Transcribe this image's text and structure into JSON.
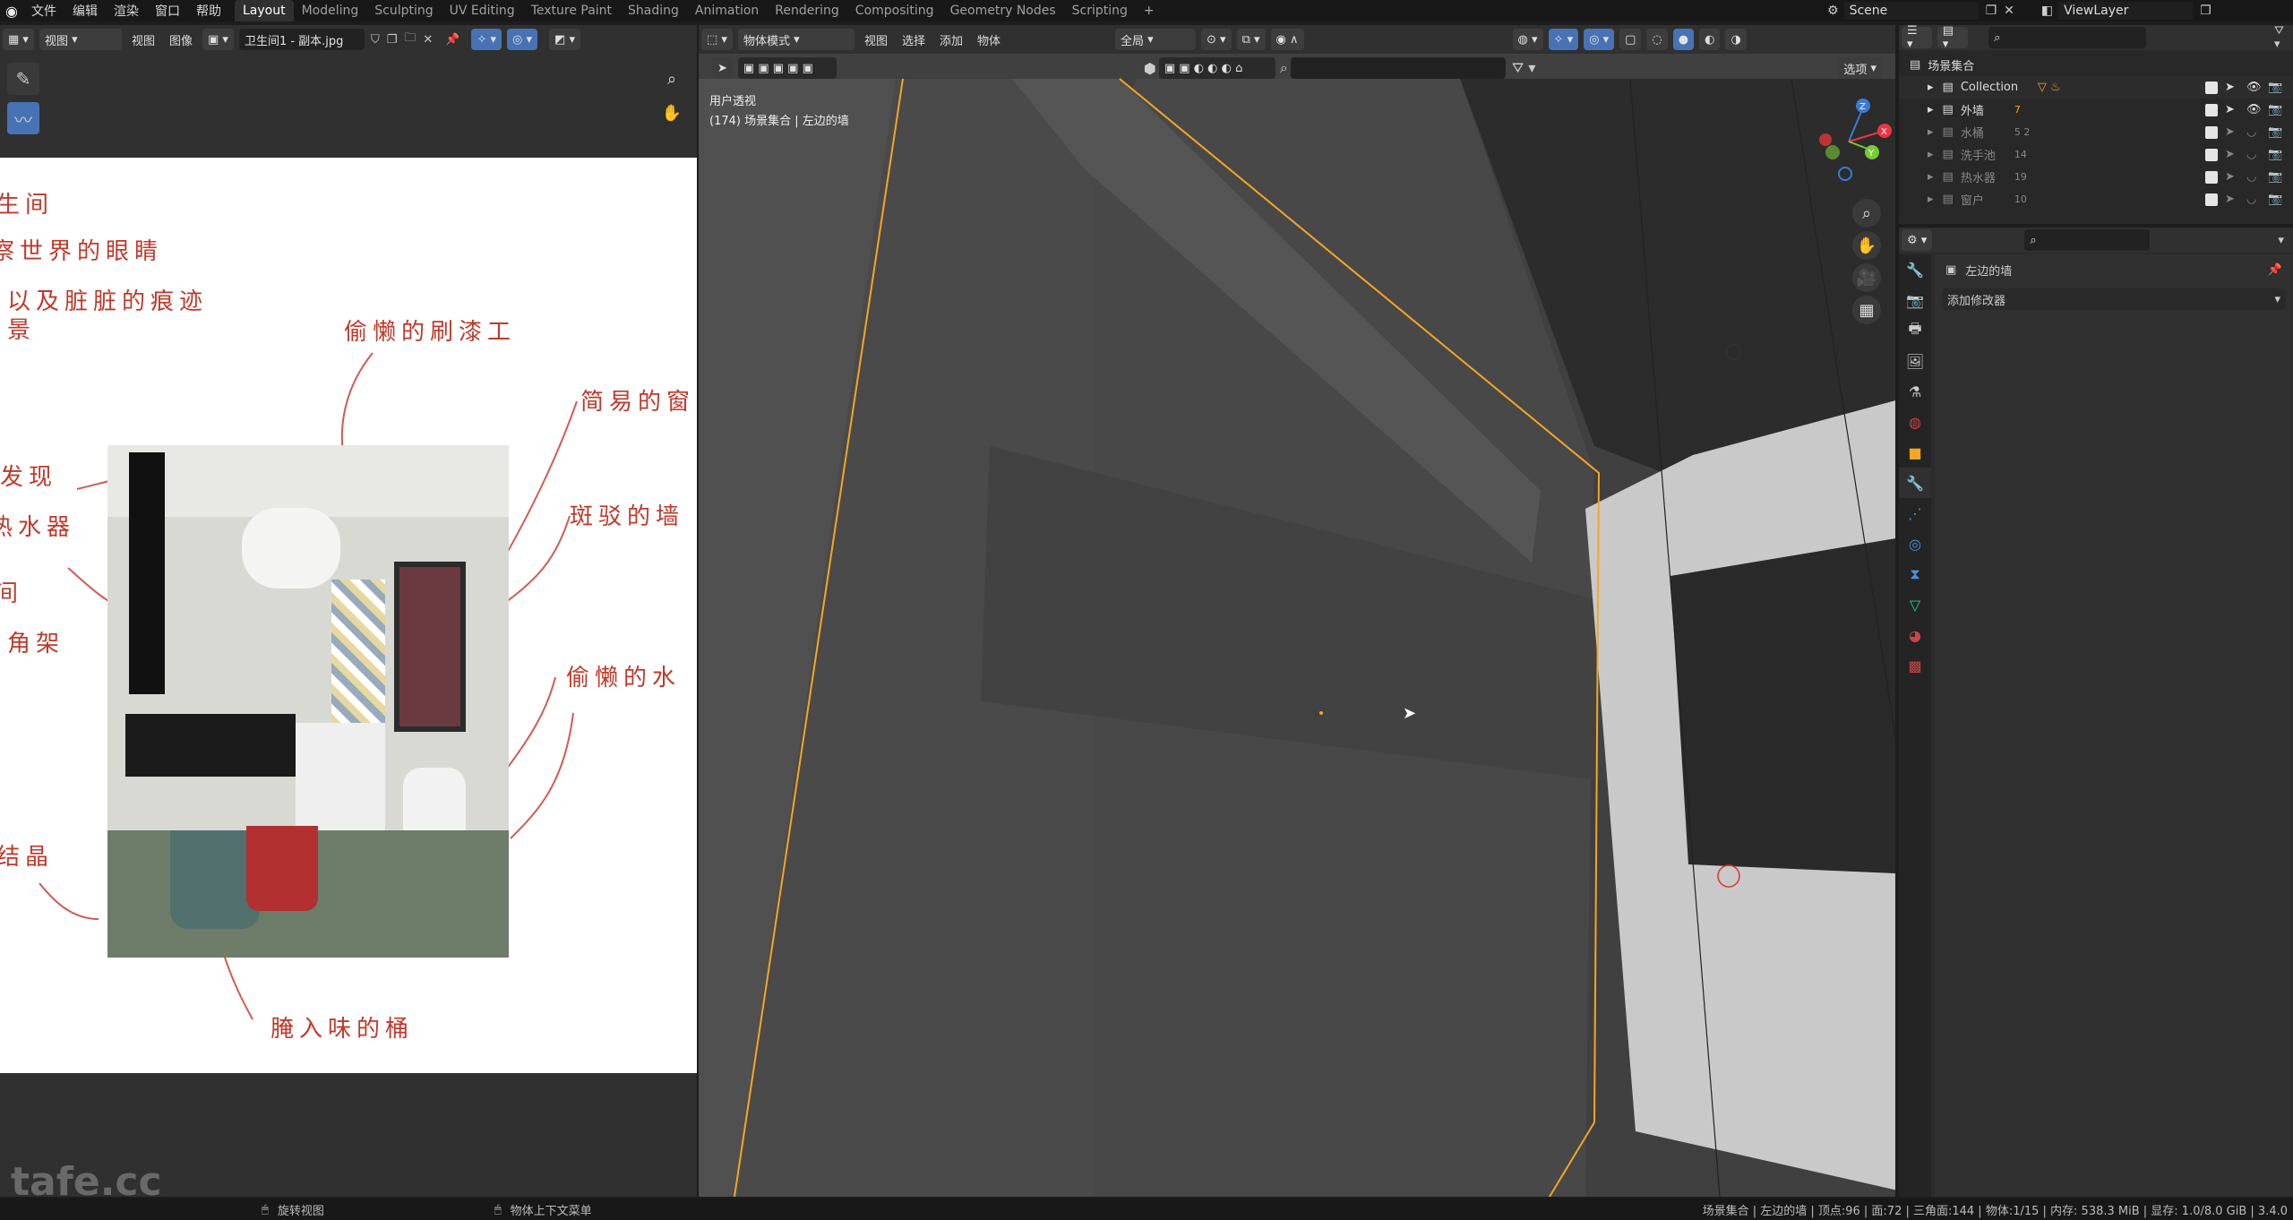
{
  "topbar": {
    "menus": [
      "文件",
      "编辑",
      "渲染",
      "窗口",
      "帮助"
    ],
    "workspaces": [
      "Layout",
      "Modeling",
      "Sculpting",
      "UV Editing",
      "Texture Paint",
      "Shading",
      "Animation",
      "Rendering",
      "Compositing",
      "Geometry Nodes",
      "Scripting"
    ],
    "active_workspace": "Layout",
    "scene": "Scene",
    "view_layer": "ViewLayer"
  },
  "image_editor": {
    "view_mode": "视图",
    "menu_view": "视图",
    "menu_image": "图像",
    "image_name": "卫生间1 - 副本.jpg",
    "annotations": [
      "生间",
      "察世界的眼睛",
      "以及脏脏的痕迹",
      "景",
      "偷懒的刷漆工",
      "简易的窗",
      "发现",
      "热水器",
      "斑驳的墙",
      "间",
      "角架",
      "偷懒的水",
      "结晶",
      "腌入味的桶"
    ]
  },
  "viewport": {
    "mode": "物体模式",
    "menus": [
      "视图",
      "选择",
      "添加",
      "物体"
    ],
    "transform_orientation": "全局",
    "options": "选项",
    "overlay_title": "用户透视",
    "overlay_sub": "(174) 场景集合 | 左边的墙",
    "gizmo_axes": [
      "Z",
      "X",
      "Y"
    ]
  },
  "outliner": {
    "root": "场景集合",
    "items": [
      {
        "name": "Collection",
        "badge": ""
      },
      {
        "name": "外墙",
        "badge": "7"
      },
      {
        "name": "水桶",
        "badge": "5 2"
      },
      {
        "name": "洗手池",
        "badge": "14"
      },
      {
        "name": "热水器",
        "badge": "19"
      },
      {
        "name": "窗户",
        "badge": "10"
      }
    ]
  },
  "properties": {
    "object_name": "左边的墙",
    "add_modifier": "添加修改器"
  },
  "statusbar": {
    "rotate_view": "旋转视图",
    "context_menu": "物体上下文菜单",
    "stats": "场景集合 | 左边的墙 | 顶点:96 | 面:72 | 三角面:144 | 物体:1/15 | 内存: 538.3 MiB | 显存: 1.0/8.0 GiB | 3.4.0"
  },
  "watermark": "tafe.cc",
  "colors": {
    "accent": "#4772b3",
    "selection_orange": "#f5a623",
    "annotation_red": "#c0392b"
  }
}
